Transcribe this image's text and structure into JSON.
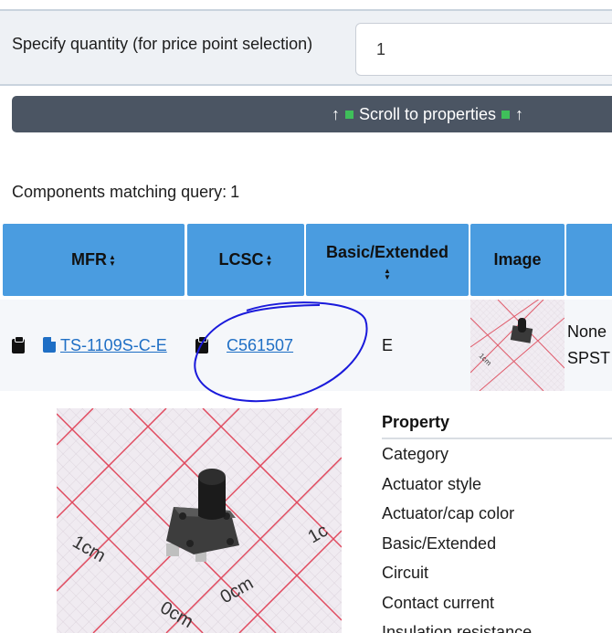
{
  "quantity": {
    "label": "Specify quantity (for price point selection)",
    "value": "1"
  },
  "scroll_button": {
    "arrow_left": "↑",
    "label": "Scroll to properties",
    "arrow_right": "↑"
  },
  "results": {
    "label": "Components matching query:",
    "count": "1"
  },
  "table": {
    "headers": {
      "mfr": "MFR",
      "lcsc": "LCSC",
      "basic_extended": "Basic/Extended",
      "image": "Image"
    },
    "row": {
      "mfr_part": "TS-1109S-C-E",
      "lcsc_part": "C561507",
      "basic_extended": "E",
      "truncated_line1": "None",
      "truncated_line2": "SPST"
    }
  },
  "properties": {
    "header": "Property",
    "items": [
      "Category",
      "Actuator style",
      "Actuator/cap color",
      "Basic/Extended",
      "Circuit",
      "Contact current",
      "Insulation resistance"
    ]
  },
  "image_labels": {
    "left_mark": "1cm",
    "bottom_mark_left": "0cm",
    "bottom_mark_right": "0cm",
    "right_mark": "1c"
  },
  "colors": {
    "header_blue": "#4a9ce0",
    "link_blue": "#1f6fc5",
    "scroll_bar": "#4b5563",
    "annotation": "#1a1adb"
  }
}
